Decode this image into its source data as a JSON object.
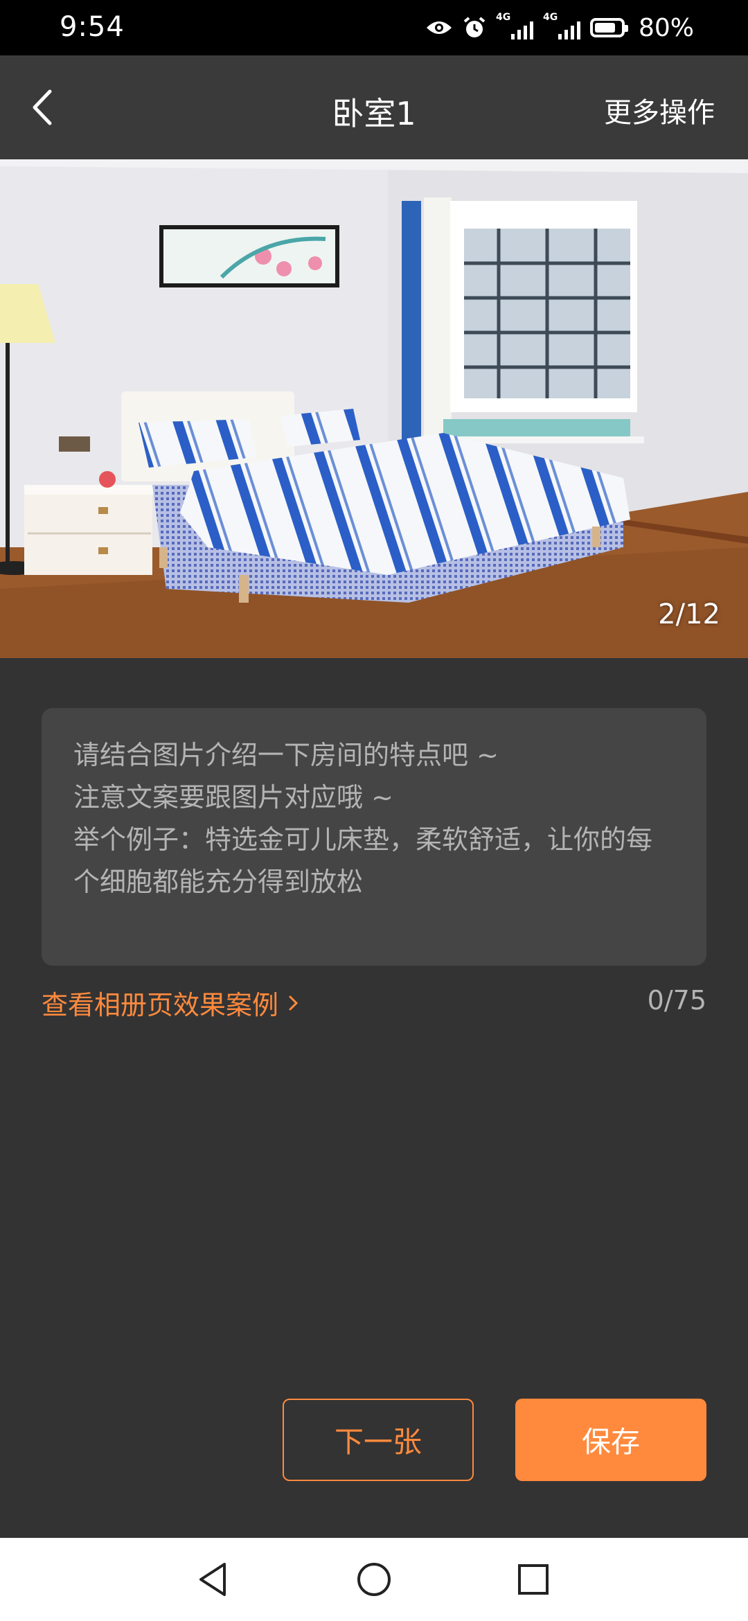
{
  "status_bar": {
    "time": "9:54",
    "net_1": "4G",
    "net_2": "4G",
    "battery": "80%"
  },
  "nav": {
    "title": "卧室1",
    "more_label": "更多操作"
  },
  "photo": {
    "counter": "2/12"
  },
  "description": {
    "placeholder": "请结合图片介绍一下房间的特点吧 ~\n注意文案要跟图片对应哦 ~\n举个例子：特选金可儿床垫，柔软舒适，让你的每个细胞都能充分得到放松",
    "value": ""
  },
  "case_link": {
    "label": "查看相册页效果案例"
  },
  "char_count": "0/75",
  "buttons": {
    "next": "下一张",
    "save": "保存"
  },
  "colors": {
    "accent": "#ff8a3d",
    "background": "#333333"
  }
}
